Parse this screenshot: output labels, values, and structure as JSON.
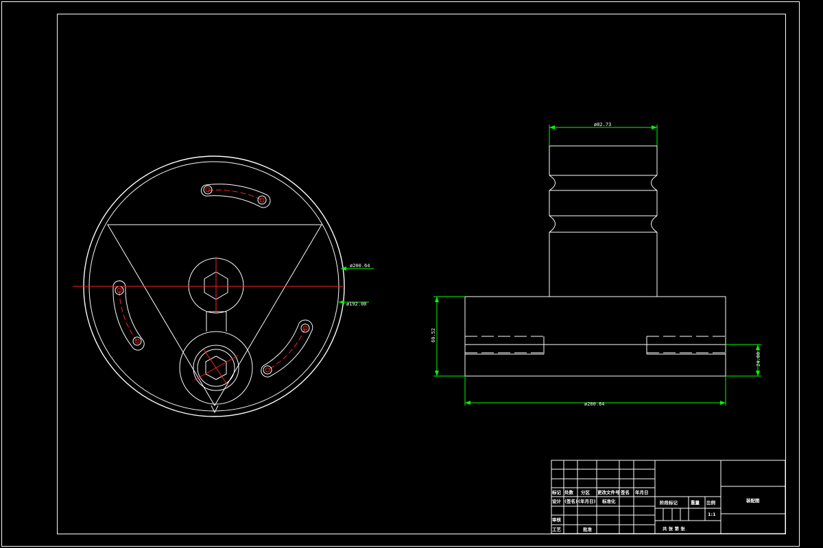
{
  "dimensions": {
    "top_view_outer_diameter": "ø200.64",
    "top_view_inner_diameter": "ø192.00",
    "side_view_shaft_diameter": "ø82.73",
    "side_view_height": "60.52",
    "side_view_slot_width": "24.00",
    "side_view_base_width": "ø200.64"
  },
  "title_block": {
    "header_labels": [
      "标记",
      "处数",
      "分区",
      "更改文件号",
      "签名",
      "年月日"
    ],
    "row_design": [
      "设计",
      "(签名)",
      "(年月日)",
      "标准化"
    ],
    "row_review": "审核",
    "row_process": "工艺",
    "approve": "批准",
    "stage_mark": "阶段标记",
    "weight": "重量",
    "scale": "比例",
    "scale_value": "1:1",
    "sheets": "共  张 第  张",
    "drawing_name": "装配图"
  }
}
